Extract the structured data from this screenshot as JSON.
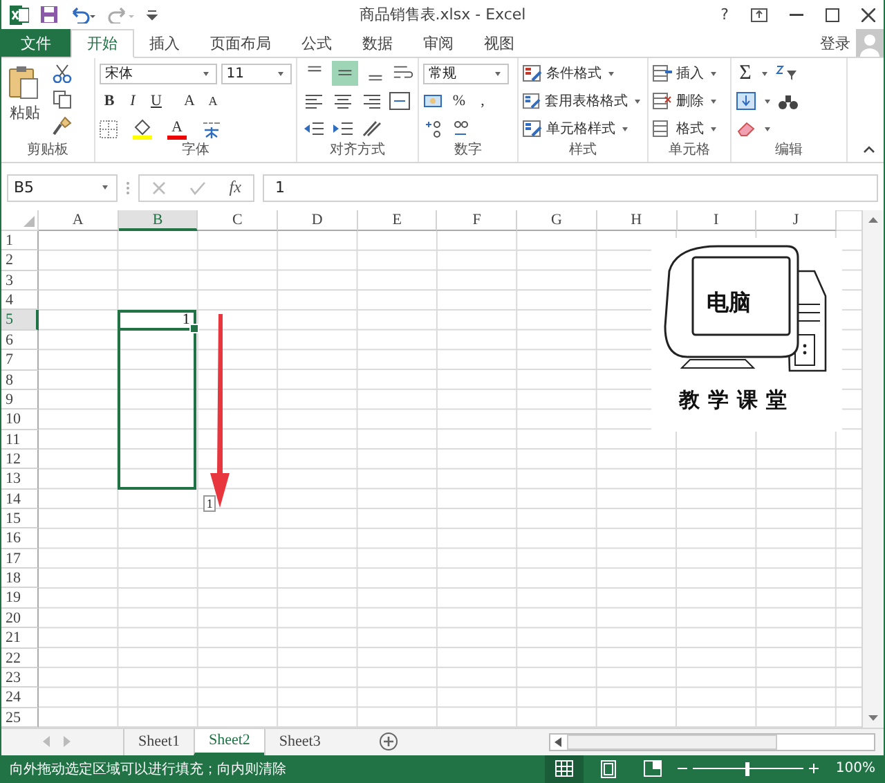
{
  "window": {
    "title": "商品销售表.xlsx - Excel",
    "help": "?"
  },
  "menu_tabs": [
    {
      "label": "文件",
      "kind": "file",
      "selected": false
    },
    {
      "label": "开始",
      "kind": "tab",
      "selected": true
    },
    {
      "label": "插入",
      "kind": "tab",
      "selected": false
    },
    {
      "label": "页面布局",
      "kind": "tab",
      "selected": false
    },
    {
      "label": "公式",
      "kind": "tab",
      "selected": false
    },
    {
      "label": "数据",
      "kind": "tab",
      "selected": false
    },
    {
      "label": "审阅",
      "kind": "tab",
      "selected": false
    },
    {
      "label": "视图",
      "kind": "tab",
      "selected": false
    }
  ],
  "sign_in": "登录",
  "ribbon": {
    "clipboard": {
      "label": "剪贴板",
      "paste": "粘贴"
    },
    "font": {
      "label": "字体",
      "font_name": "宋体",
      "font_size": "11",
      "bold": "B",
      "italic": "I",
      "underline": "U",
      "grow": "A",
      "shrink": "A",
      "font_color": "A"
    },
    "alignment": {
      "label": "对齐方式",
      "vertical": [
        {
          "selected": false
        },
        {
          "selected": true
        },
        {
          "selected": false
        }
      ]
    },
    "number": {
      "label": "数字",
      "format": "常规",
      "percent": "%",
      "comma": ","
    },
    "styles": {
      "label": "样式",
      "items": [
        "条件格式",
        "套用表格格式",
        "单元格样式"
      ]
    },
    "cells": {
      "label": "单元格",
      "items": [
        "插入",
        "删除",
        "格式"
      ]
    },
    "editing": {
      "label": "编辑",
      "sum": "Σ"
    }
  },
  "formula_bar": {
    "name_box": "B5",
    "fx": "fx",
    "content": "1"
  },
  "sheet": {
    "columns": [
      {
        "label": "A",
        "selected": false
      },
      {
        "label": "B",
        "selected": true
      },
      {
        "label": "C",
        "selected": false
      },
      {
        "label": "D",
        "selected": false
      },
      {
        "label": "E",
        "selected": false
      },
      {
        "label": "F",
        "selected": false
      },
      {
        "label": "G",
        "selected": false
      },
      {
        "label": "H",
        "selected": false
      },
      {
        "label": "I",
        "selected": false
      },
      {
        "label": "J",
        "selected": false
      }
    ],
    "rows": [
      {
        "label": "1",
        "selected": false,
        "in_range": false
      },
      {
        "label": "2",
        "selected": false,
        "in_range": false
      },
      {
        "label": "3",
        "selected": false,
        "in_range": false
      },
      {
        "label": "4",
        "selected": false,
        "in_range": false
      },
      {
        "label": "5",
        "selected": true,
        "in_range": true,
        "cells": [
          null,
          "1"
        ]
      },
      {
        "label": "6",
        "selected": false,
        "in_range": true
      },
      {
        "label": "7",
        "selected": false,
        "in_range": true
      },
      {
        "label": "8",
        "selected": false,
        "in_range": true
      },
      {
        "label": "9",
        "selected": false,
        "in_range": true
      },
      {
        "label": "10",
        "selected": false,
        "in_range": true
      },
      {
        "label": "11",
        "selected": false,
        "in_range": true
      },
      {
        "label": "12",
        "selected": false,
        "in_range": true
      },
      {
        "label": "13",
        "selected": false,
        "in_range": true
      },
      {
        "label": "14",
        "selected": false,
        "in_range": false
      },
      {
        "label": "15",
        "selected": false,
        "in_range": false
      },
      {
        "label": "16",
        "selected": false,
        "in_range": false
      },
      {
        "label": "17",
        "selected": false,
        "in_range": false
      },
      {
        "label": "18",
        "selected": false,
        "in_range": false
      },
      {
        "label": "19",
        "selected": false,
        "in_range": false
      },
      {
        "label": "20",
        "selected": false,
        "in_range": false
      },
      {
        "label": "21",
        "selected": false,
        "in_range": false
      },
      {
        "label": "22",
        "selected": false,
        "in_range": false
      },
      {
        "label": "23",
        "selected": false,
        "in_range": false
      },
      {
        "label": "24",
        "selected": false,
        "in_range": false
      },
      {
        "label": "25",
        "selected": false,
        "in_range": false
      }
    ],
    "fill_tooltip": "1",
    "logo": {
      "screen_text": "电脑",
      "caption": "教学课堂"
    }
  },
  "sheet_tabs": [
    {
      "label": "Sheet1",
      "selected": false
    },
    {
      "label": "Sheet2",
      "selected": true
    },
    {
      "label": "Sheet3",
      "selected": false
    }
  ],
  "status_bar": {
    "message": "向外拖动选定区域可以进行填充；向内则清除",
    "zoom": {
      "level": 0.5
    },
    "zoom_text": "100%"
  }
}
